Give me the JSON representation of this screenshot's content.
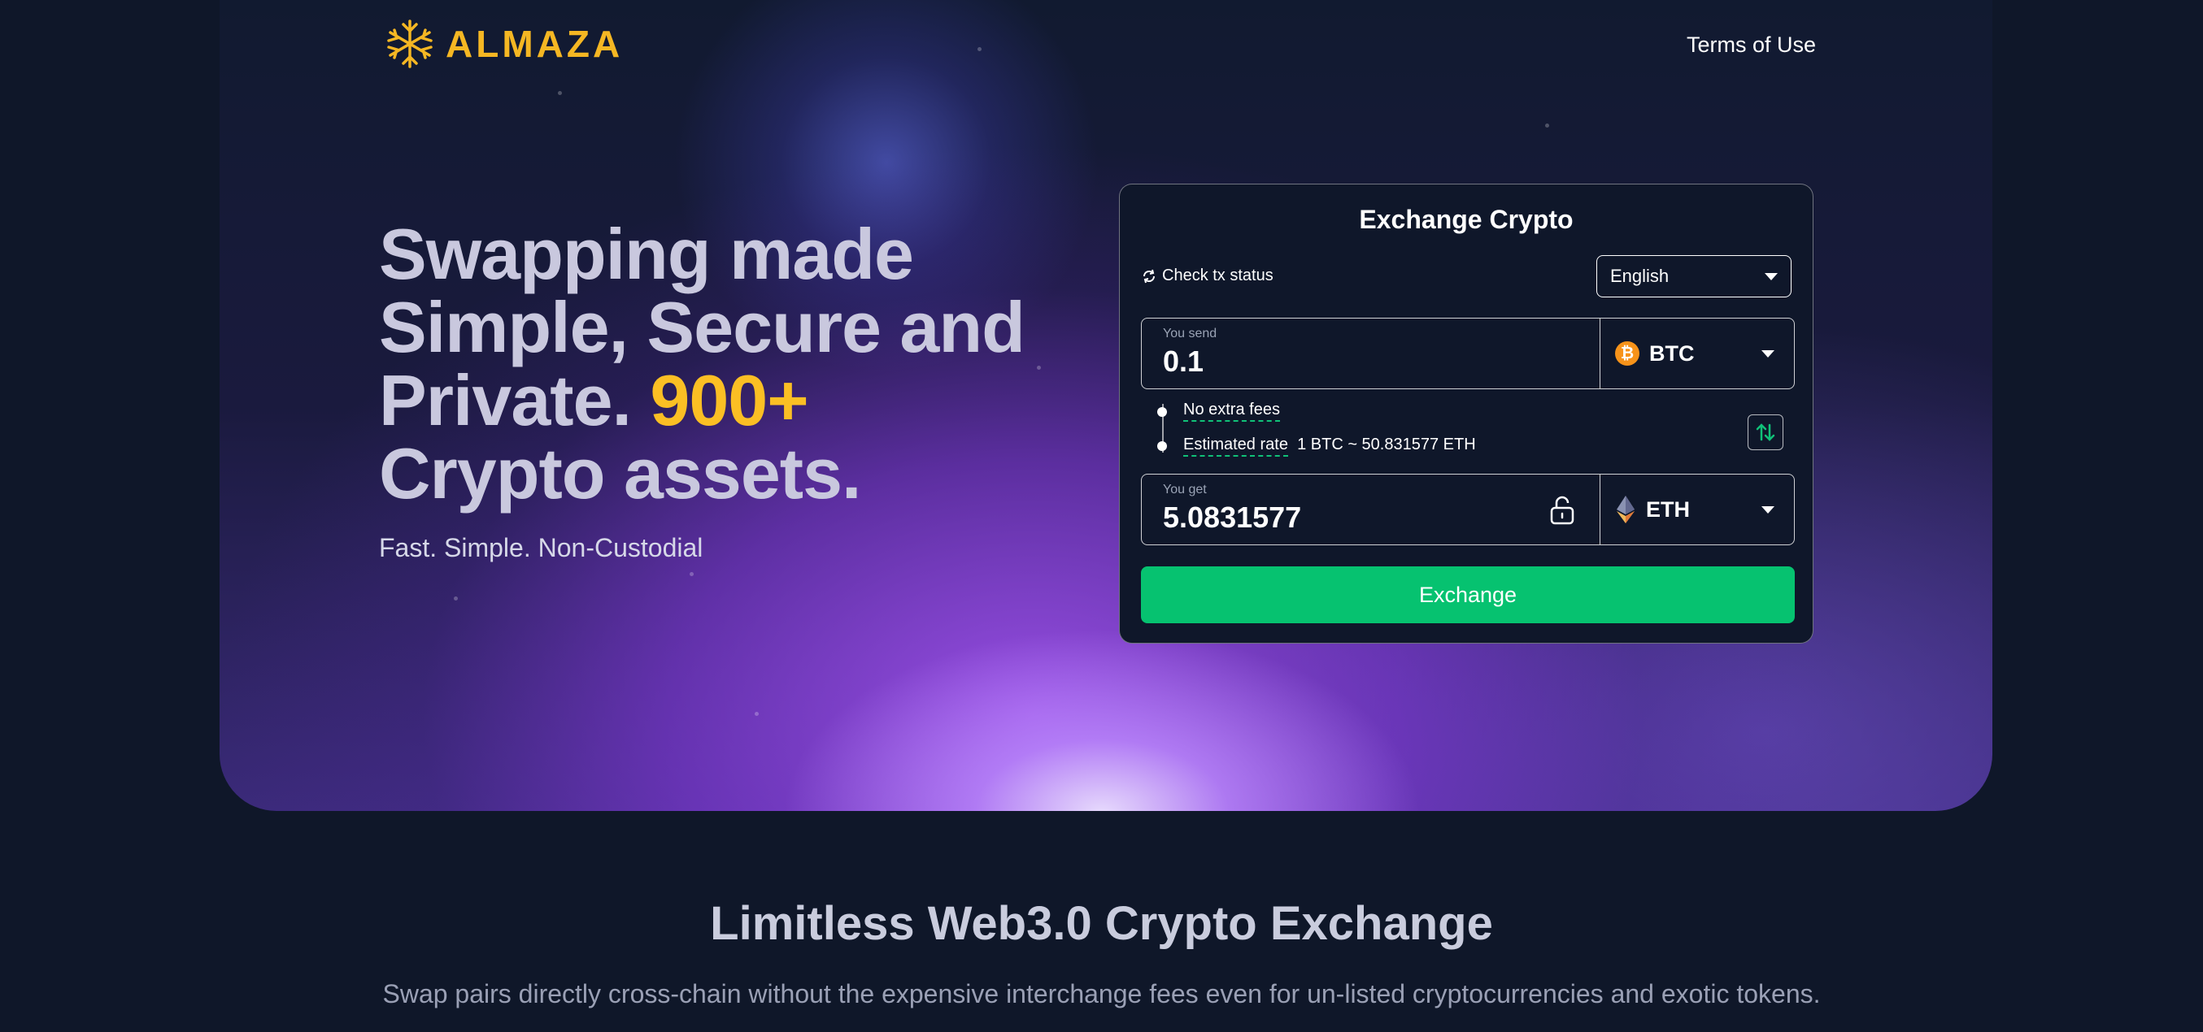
{
  "brand": {
    "name": "ALMAZA",
    "color": "#f5b723"
  },
  "nav": {
    "terms": "Terms of Use"
  },
  "hero": {
    "headline_line1": "Swapping made",
    "headline_line2": "Simple, Secure and",
    "headline_line3a": "Private.",
    "headline_accent": "900+",
    "headline_line4": "Crypto assets.",
    "tagline": "Fast. Simple. Non-Custodial"
  },
  "exchange": {
    "title": "Exchange Crypto",
    "check_status": "Check tx status",
    "language": "English",
    "send": {
      "label": "You send",
      "value": "0.1",
      "coin": "BTC",
      "coin_icon": "bitcoin-icon"
    },
    "get": {
      "label": "You get",
      "value": "5.0831577",
      "coin": "ETH",
      "coin_icon": "ethereum-icon"
    },
    "no_fees": "No extra fees",
    "estimated_rate_label": "Estimated rate",
    "estimated_rate_value": "1 BTC ~ 50.831577 ETH",
    "button": "Exchange",
    "button_color": "#06c270"
  },
  "section": {
    "title": "Limitless Web3.0 Crypto Exchange",
    "subtitle": "Swap pairs directly cross-chain without the expensive interchange fees even for un-listed cryptocurrencies and exotic tokens."
  }
}
